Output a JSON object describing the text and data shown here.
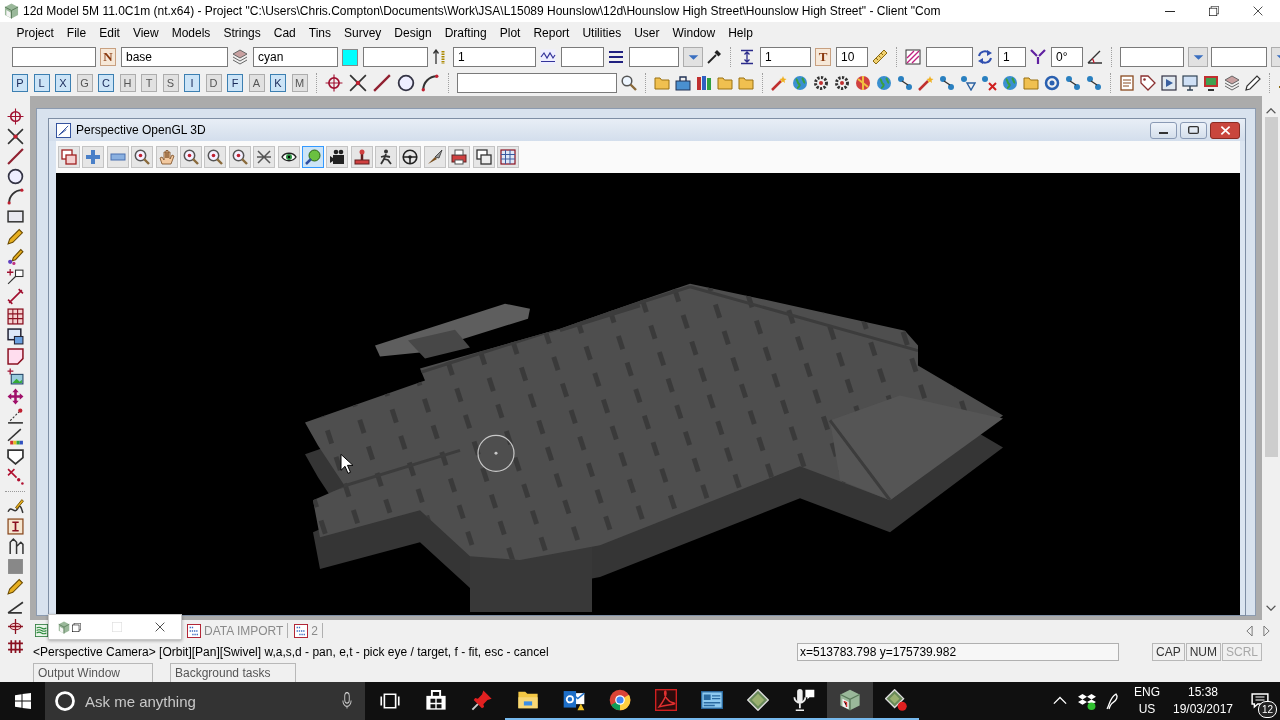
{
  "window": {
    "title": "12d Model 5M 11.0C1m (nt.x64) - Project \"C:\\Users\\Chris.Compton\\Documents\\Work\\JSA\\L15089 Hounslow\\12d\\Hounslow High Street\\Hounslow High Street\" - Client \"Com"
  },
  "menu": [
    "Project",
    "File",
    "Edit",
    "View",
    "Models",
    "Strings",
    "Cad",
    "Tins",
    "Survey",
    "Design",
    "Drafting",
    "Plot",
    "Report",
    "Utilities",
    "User",
    "Window",
    "Help"
  ],
  "toolbar": [
    {
      "kind": "field"
    },
    {
      "kind": "letter",
      "label": "N"
    },
    {
      "kind": "field",
      "value": "base"
    },
    {
      "kind": "field",
      "value": "cyan"
    },
    {
      "kind": "swatch",
      "color": "#00ffff"
    },
    {
      "kind": "field"
    },
    {
      "kind": "field",
      "value": "1"
    },
    {
      "kind": "field"
    },
    {
      "kind": "combo"
    },
    {
      "kind": "field",
      "value": "1"
    },
    {
      "kind": "letter",
      "label": "T"
    },
    {
      "kind": "field",
      "value": "10"
    },
    {
      "kind": "field"
    },
    {
      "kind": "field",
      "value": "1"
    },
    {
      "kind": "field",
      "value": "0°"
    },
    {
      "kind": "combo"
    },
    {
      "kind": "combo"
    }
  ],
  "filters": [
    {
      "label": "P",
      "selected": true
    },
    {
      "label": "L",
      "selected": true
    },
    {
      "label": "X",
      "selected": true
    },
    {
      "label": "G",
      "selected": false
    },
    {
      "label": "C",
      "selected": true
    },
    {
      "label": "H",
      "selected": false
    },
    {
      "label": "T",
      "selected": false
    },
    {
      "label": "S",
      "selected": false
    },
    {
      "label": "I",
      "selected": true
    },
    {
      "label": "D",
      "selected": false
    },
    {
      "label": "F",
      "selected": true
    },
    {
      "label": "A",
      "selected": false
    },
    {
      "label": "K",
      "selected": true
    },
    {
      "label": "M",
      "selected": false
    }
  ],
  "view_window": {
    "title": "Perspective OpenGL 3D",
    "tools": [
      {
        "selected": false
      },
      {
        "selected": false
      },
      {
        "selected": false
      },
      {
        "selected": false
      },
      {
        "selected": false
      },
      {
        "selected": false
      },
      {
        "selected": false
      },
      {
        "selected": false
      },
      {
        "selected": false
      },
      {
        "selected": false
      },
      {
        "selected": true
      },
      {
        "selected": false
      },
      {
        "selected": false
      },
      {
        "selected": false
      },
      {
        "selected": false
      },
      {
        "selected": false
      },
      {
        "selected": false
      },
      {
        "selected": false
      },
      {
        "selected": false
      }
    ]
  },
  "view_tabs": [
    {
      "label": "DATA IMPORT"
    },
    {
      "label": "2"
    }
  ],
  "status_bar": {
    "prompt": "<Perspective Camera> [Orbit][Pan][Swivel] w,a,s,d - pan, e,t - pick eye / target, f - fit, esc - cancel",
    "coordinates": "x=513783.798 y=175739.982",
    "indicators": [
      {
        "label": "CAP",
        "on": true
      },
      {
        "label": "NUM",
        "on": true
      },
      {
        "label": "SCRL",
        "on": false
      }
    ]
  },
  "docked_windows": [
    {
      "label": "Output Window"
    },
    {
      "label": "Background tasks"
    }
  ],
  "taskbar": {
    "search_placeholder": "Ask me anything",
    "apps": [
      {
        "running": false,
        "selected": false
      },
      {
        "running": false,
        "selected": false
      },
      {
        "running": true,
        "selected": false
      },
      {
        "running": true,
        "selected": false
      },
      {
        "running": true,
        "selected": false
      },
      {
        "running": true,
        "selected": false
      },
      {
        "running": true,
        "selected": false
      },
      {
        "running": true,
        "selected": false
      },
      {
        "running": true,
        "selected": false
      },
      {
        "running": true,
        "selected": true
      },
      {
        "running": true,
        "selected": false
      }
    ],
    "language": "ENG",
    "region": "US",
    "time": "15:38",
    "date": "19/03/2017",
    "notifications": "12"
  }
}
